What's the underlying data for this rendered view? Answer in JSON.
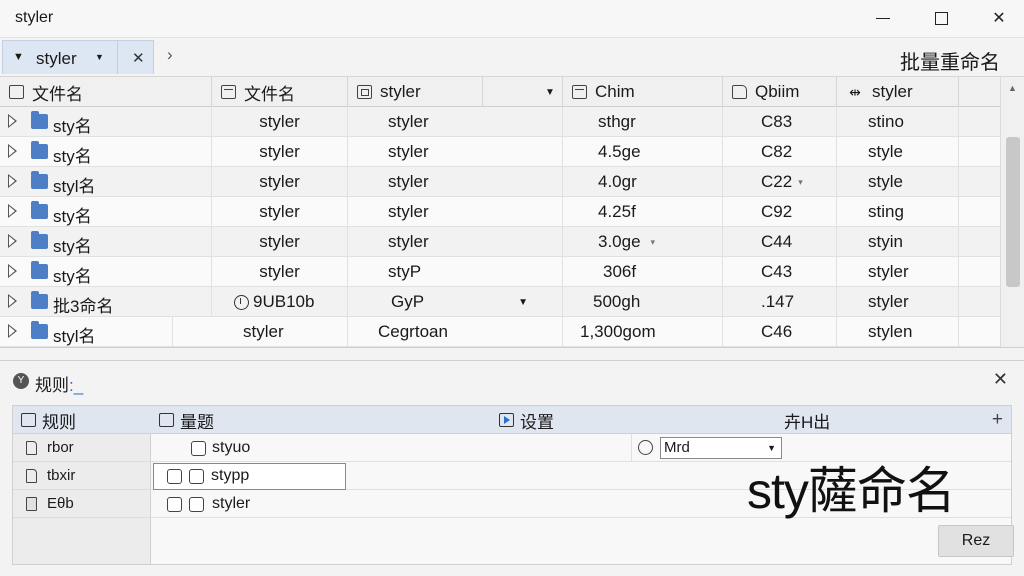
{
  "window": {
    "title": "styler"
  },
  "tabs": [
    {
      "label": "styler"
    }
  ],
  "header": {
    "batch_title": "批量重命名"
  },
  "grid": {
    "columns": [
      "文件名",
      "文件名",
      "styler",
      "Chim",
      "Qbiim",
      "styler"
    ],
    "rows": [
      {
        "name": "sty名",
        "c2": "styler",
        "c3": "styler",
        "c4": "sthgr",
        "c5": "C83",
        "c6": "stino"
      },
      {
        "name": "sty名",
        "c2": "styler",
        "c3": "styler",
        "c4": "4.5ge",
        "c5": "C82",
        "c6": "style"
      },
      {
        "name": "styl名",
        "c2": "styler",
        "c3": "styler",
        "c4": "4.0gr",
        "c5": "C22",
        "c6": "style"
      },
      {
        "name": "sty名",
        "c2": "styler",
        "c3": "styler",
        "c4": "4.25f",
        "c5": "C92",
        "c6": "sting"
      },
      {
        "name": "sty名",
        "c2": "styler",
        "c3": "styler",
        "c4": "3.0ge",
        "c5": "C44",
        "c6": "styin"
      },
      {
        "name": "sty名",
        "c2": "styler",
        "c3": "styP",
        "c4": "306f",
        "c5": "C43",
        "c6": "styler"
      },
      {
        "name": "批3命名",
        "c2": "9UB10b",
        "c3": "GyP",
        "c4": "500gh",
        "c5": ".147",
        "c6": "styler"
      },
      {
        "name": "styl名",
        "c2": "styler",
        "c3": "Cegrtoan",
        "c4": "1,300gom",
        "c5": "C46",
        "c6": "stylen"
      }
    ]
  },
  "rules": {
    "title": "规则",
    "header": {
      "col1": "规则",
      "col2": "量题",
      "col3": "设置",
      "col4": "卉H出"
    },
    "items": [
      "rbor",
      "tbxir",
      "Eθb"
    ],
    "rows": [
      {
        "text": "styuo"
      },
      {
        "text": "stypp"
      },
      {
        "text": "styler"
      }
    ],
    "select_value": "Mrd"
  },
  "preview": {
    "text": "sty薩命名"
  },
  "buttons": {
    "rez": "Rez"
  }
}
